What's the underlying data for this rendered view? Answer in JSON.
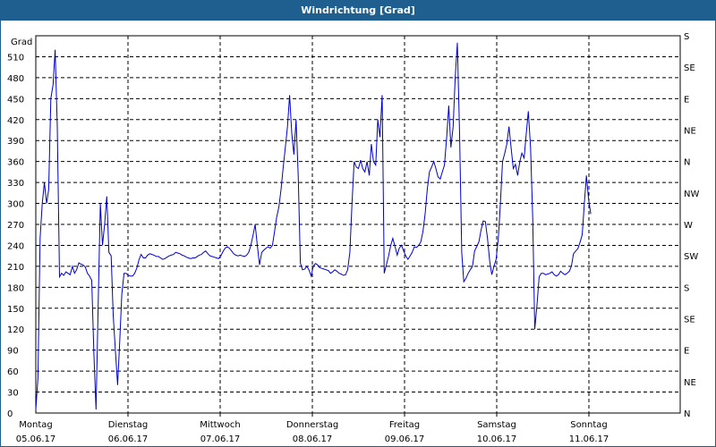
{
  "window": {
    "title": "Windrichtung [Grad]"
  },
  "chart_data": {
    "type": "line",
    "title": "Windrichtung [Grad]",
    "ylabel": "Grad",
    "ylim": [
      0,
      540
    ],
    "grid": true,
    "y_ticks": [
      0,
      30,
      60,
      90,
      120,
      150,
      180,
      210,
      240,
      270,
      300,
      330,
      360,
      390,
      420,
      450,
      480,
      510
    ],
    "right_labels": [
      "N",
      "NE",
      "E",
      "SE",
      "S",
      "SW",
      "W",
      "NW",
      "N",
      "NE",
      "E",
      "SE",
      "S"
    ],
    "x_tick_labels": [
      {
        "day": "Montag",
        "date": "05.06.17"
      },
      {
        "day": "Dienstag",
        "date": "06.06.17"
      },
      {
        "day": "Mittwoch",
        "date": "07.06.17"
      },
      {
        "day": "Donnerstag",
        "date": "08.06.17"
      },
      {
        "day": "Freitag",
        "date": "09.06.17"
      },
      {
        "day": "Samstag",
        "date": "10.06.17"
      },
      {
        "day": "Sonntag",
        "date": "11.06.17"
      }
    ],
    "x_range_days": [
      0,
      7
    ],
    "series": [
      {
        "color": "#0000cc",
        "points": [
          [
            0.0,
            5
          ],
          [
            0.023,
            50
          ],
          [
            0.047,
            250
          ],
          [
            0.07,
            300
          ],
          [
            0.093,
            330
          ],
          [
            0.117,
            300
          ],
          [
            0.14,
            320
          ],
          [
            0.163,
            450
          ],
          [
            0.187,
            470
          ],
          [
            0.21,
            520
          ],
          [
            0.233,
            410
          ],
          [
            0.257,
            195
          ],
          [
            0.28,
            200
          ],
          [
            0.303,
            197
          ],
          [
            0.327,
            202
          ],
          [
            0.35,
            200
          ],
          [
            0.373,
            198
          ],
          [
            0.397,
            210
          ],
          [
            0.42,
            200
          ],
          [
            0.443,
            205
          ],
          [
            0.467,
            215
          ],
          [
            0.49,
            213
          ],
          [
            0.513,
            212
          ],
          [
            0.537,
            209
          ],
          [
            0.56,
            200
          ],
          [
            0.583,
            196
          ],
          [
            0.607,
            190
          ],
          [
            0.63,
            85
          ],
          [
            0.653,
            5
          ],
          [
            0.677,
            155
          ],
          [
            0.7,
            300
          ],
          [
            0.723,
            240
          ],
          [
            0.747,
            270
          ],
          [
            0.77,
            310
          ],
          [
            0.793,
            230
          ],
          [
            0.817,
            225
          ],
          [
            0.84,
            140
          ],
          [
            0.863,
            90
          ],
          [
            0.887,
            40
          ],
          [
            0.91,
            100
          ],
          [
            0.933,
            170
          ],
          [
            0.957,
            200
          ],
          [
            0.98,
            200
          ],
          [
            1.003,
            197
          ],
          [
            1.027,
            196
          ],
          [
            1.05,
            196
          ],
          [
            1.073,
            200
          ],
          [
            1.097,
            208
          ],
          [
            1.12,
            220
          ],
          [
            1.143,
            227
          ],
          [
            1.167,
            222
          ],
          [
            1.19,
            222
          ],
          [
            1.213,
            226
          ],
          [
            1.237,
            228
          ],
          [
            1.26,
            227
          ],
          [
            1.283,
            226
          ],
          [
            1.307,
            224
          ],
          [
            1.33,
            224
          ],
          [
            1.353,
            222
          ],
          [
            1.377,
            220
          ],
          [
            1.4,
            221
          ],
          [
            1.423,
            223
          ],
          [
            1.447,
            225
          ],
          [
            1.47,
            226
          ],
          [
            1.493,
            227
          ],
          [
            1.517,
            230
          ],
          [
            1.54,
            229
          ],
          [
            1.563,
            228
          ],
          [
            1.587,
            226
          ],
          [
            1.61,
            225
          ],
          [
            1.633,
            223
          ],
          [
            1.657,
            222
          ],
          [
            1.68,
            221
          ],
          [
            1.703,
            222
          ],
          [
            1.727,
            222
          ],
          [
            1.75,
            224
          ],
          [
            1.773,
            226
          ],
          [
            1.797,
            227
          ],
          [
            1.82,
            230
          ],
          [
            1.843,
            232
          ],
          [
            1.867,
            228
          ],
          [
            1.89,
            225
          ],
          [
            1.913,
            224
          ],
          [
            1.937,
            223
          ],
          [
            1.96,
            222
          ],
          [
            1.983,
            221
          ],
          [
            2.007,
            225
          ],
          [
            2.03,
            231
          ],
          [
            2.053,
            236
          ],
          [
            2.077,
            238
          ],
          [
            2.1,
            236
          ],
          [
            2.123,
            232
          ],
          [
            2.147,
            228
          ],
          [
            2.17,
            226
          ],
          [
            2.193,
            225
          ],
          [
            2.217,
            226
          ],
          [
            2.24,
            225
          ],
          [
            2.263,
            224
          ],
          [
            2.287,
            226
          ],
          [
            2.31,
            230
          ],
          [
            2.333,
            240
          ],
          [
            2.357,
            255
          ],
          [
            2.38,
            270
          ],
          [
            2.403,
            240
          ],
          [
            2.427,
            212
          ],
          [
            2.45,
            230
          ],
          [
            2.473,
            233
          ],
          [
            2.497,
            236
          ],
          [
            2.52,
            238
          ],
          [
            2.543,
            236
          ],
          [
            2.567,
            240
          ],
          [
            2.59,
            260
          ],
          [
            2.613,
            280
          ],
          [
            2.637,
            295
          ],
          [
            2.66,
            320
          ],
          [
            2.683,
            350
          ],
          [
            2.707,
            380
          ],
          [
            2.73,
            410
          ],
          [
            2.753,
            455
          ],
          [
            2.777,
            400
          ],
          [
            2.8,
            370
          ],
          [
            2.823,
            420
          ],
          [
            2.847,
            340
          ],
          [
            2.87,
            215
          ],
          [
            2.893,
            205
          ],
          [
            2.917,
            206
          ],
          [
            2.94,
            210
          ],
          [
            2.963,
            205
          ],
          [
            2.987,
            196
          ],
          [
            3.01,
            210
          ],
          [
            3.033,
            214
          ],
          [
            3.057,
            212
          ],
          [
            3.08,
            208
          ],
          [
            3.103,
            207
          ],
          [
            3.127,
            206
          ],
          [
            3.15,
            205
          ],
          [
            3.173,
            204
          ],
          [
            3.197,
            200
          ],
          [
            3.22,
            202
          ],
          [
            3.243,
            205
          ],
          [
            3.267,
            203
          ],
          [
            3.29,
            200
          ],
          [
            3.313,
            199
          ],
          [
            3.337,
            197
          ],
          [
            3.36,
            198
          ],
          [
            3.383,
            205
          ],
          [
            3.407,
            230
          ],
          [
            3.43,
            300
          ],
          [
            3.453,
            360
          ],
          [
            3.477,
            352
          ],
          [
            3.5,
            350
          ],
          [
            3.523,
            362
          ],
          [
            3.547,
            350
          ],
          [
            3.57,
            345
          ],
          [
            3.593,
            360
          ],
          [
            3.617,
            340
          ],
          [
            3.64,
            385
          ],
          [
            3.663,
            360
          ],
          [
            3.687,
            355
          ],
          [
            3.71,
            420
          ],
          [
            3.733,
            395
          ],
          [
            3.757,
            455
          ],
          [
            3.78,
            200
          ],
          [
            3.803,
            212
          ],
          [
            3.827,
            225
          ],
          [
            3.85,
            240
          ],
          [
            3.873,
            250
          ],
          [
            3.897,
            238
          ],
          [
            3.92,
            226
          ],
          [
            3.943,
            236
          ],
          [
            3.967,
            240
          ],
          [
            3.99,
            232
          ],
          [
            4.013,
            225
          ],
          [
            4.037,
            220
          ],
          [
            4.06,
            225
          ],
          [
            4.083,
            230
          ],
          [
            4.107,
            238
          ],
          [
            4.13,
            237
          ],
          [
            4.153,
            240
          ],
          [
            4.177,
            245
          ],
          [
            4.2,
            260
          ],
          [
            4.223,
            285
          ],
          [
            4.247,
            320
          ],
          [
            4.27,
            345
          ],
          [
            4.293,
            352
          ],
          [
            4.317,
            360
          ],
          [
            4.34,
            350
          ],
          [
            4.363,
            338
          ],
          [
            4.387,
            335
          ],
          [
            4.41,
            345
          ],
          [
            4.433,
            355
          ],
          [
            4.457,
            395
          ],
          [
            4.48,
            440
          ],
          [
            4.503,
            380
          ],
          [
            4.527,
            410
          ],
          [
            4.55,
            480
          ],
          [
            4.573,
            530
          ],
          [
            4.597,
            400
          ],
          [
            4.62,
            230
          ],
          [
            4.643,
            188
          ],
          [
            4.667,
            193
          ],
          [
            4.69,
            200
          ],
          [
            4.713,
            205
          ],
          [
            4.737,
            210
          ],
          [
            4.76,
            232
          ],
          [
            4.783,
            238
          ],
          [
            4.807,
            245
          ],
          [
            4.83,
            262
          ],
          [
            4.853,
            275
          ],
          [
            4.877,
            274
          ],
          [
            4.9,
            250
          ],
          [
            4.923,
            218
          ],
          [
            4.947,
            198
          ],
          [
            4.97,
            210
          ],
          [
            4.993,
            220
          ],
          [
            5.017,
            250
          ],
          [
            5.04,
            300
          ],
          [
            5.063,
            360
          ],
          [
            5.087,
            372
          ],
          [
            5.11,
            385
          ],
          [
            5.133,
            410
          ],
          [
            5.157,
            378
          ],
          [
            5.18,
            350
          ],
          [
            5.203,
            356
          ],
          [
            5.227,
            340
          ],
          [
            5.25,
            360
          ],
          [
            5.273,
            372
          ],
          [
            5.297,
            365
          ],
          [
            5.32,
            400
          ],
          [
            5.343,
            432
          ],
          [
            5.367,
            380
          ],
          [
            5.39,
            280
          ],
          [
            5.413,
            120
          ],
          [
            5.437,
            155
          ],
          [
            5.46,
            195
          ],
          [
            5.483,
            200
          ],
          [
            5.507,
            200
          ],
          [
            5.53,
            198
          ],
          [
            5.553,
            199
          ],
          [
            5.577,
            200
          ],
          [
            5.6,
            202
          ],
          [
            5.623,
            198
          ],
          [
            5.647,
            196
          ],
          [
            5.67,
            198
          ],
          [
            5.693,
            203
          ],
          [
            5.717,
            200
          ],
          [
            5.74,
            198
          ],
          [
            5.763,
            200
          ],
          [
            5.787,
            203
          ],
          [
            5.81,
            210
          ],
          [
            5.833,
            228
          ],
          [
            5.857,
            232
          ],
          [
            5.88,
            235
          ],
          [
            5.903,
            244
          ],
          [
            5.927,
            255
          ],
          [
            5.95,
            300
          ],
          [
            5.973,
            340
          ],
          [
            5.997,
            305
          ],
          [
            6.02,
            285
          ]
        ]
      }
    ]
  }
}
